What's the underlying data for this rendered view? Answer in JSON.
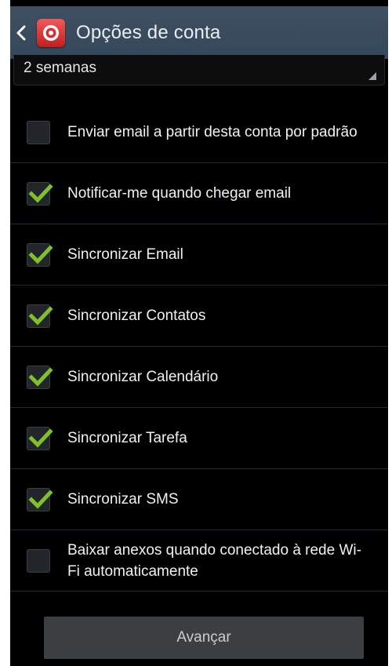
{
  "actionbar": {
    "title": "Opções de conta"
  },
  "sync_period": {
    "value": "2 semanas"
  },
  "options": [
    {
      "label": "Enviar email a partir desta conta por padrão",
      "checked": false
    },
    {
      "label": "Notificar-me quando chegar email",
      "checked": true
    },
    {
      "label": "Sincronizar Email",
      "checked": true
    },
    {
      "label": "Sincronizar Contatos",
      "checked": true
    },
    {
      "label": "Sincronizar Calendário",
      "checked": true
    },
    {
      "label": "Sincronizar Tarefa",
      "checked": true
    },
    {
      "label": "Sincronizar SMS",
      "checked": true
    },
    {
      "label": "Baixar anexos quando conectado à rede Wi-Fi automaticamente",
      "checked": false
    }
  ],
  "footer": {
    "next_label": "Avançar"
  },
  "colors": {
    "check": "#7ec12b",
    "actionbar": "#3a4c5e",
    "app_icon": "#d9302f"
  }
}
